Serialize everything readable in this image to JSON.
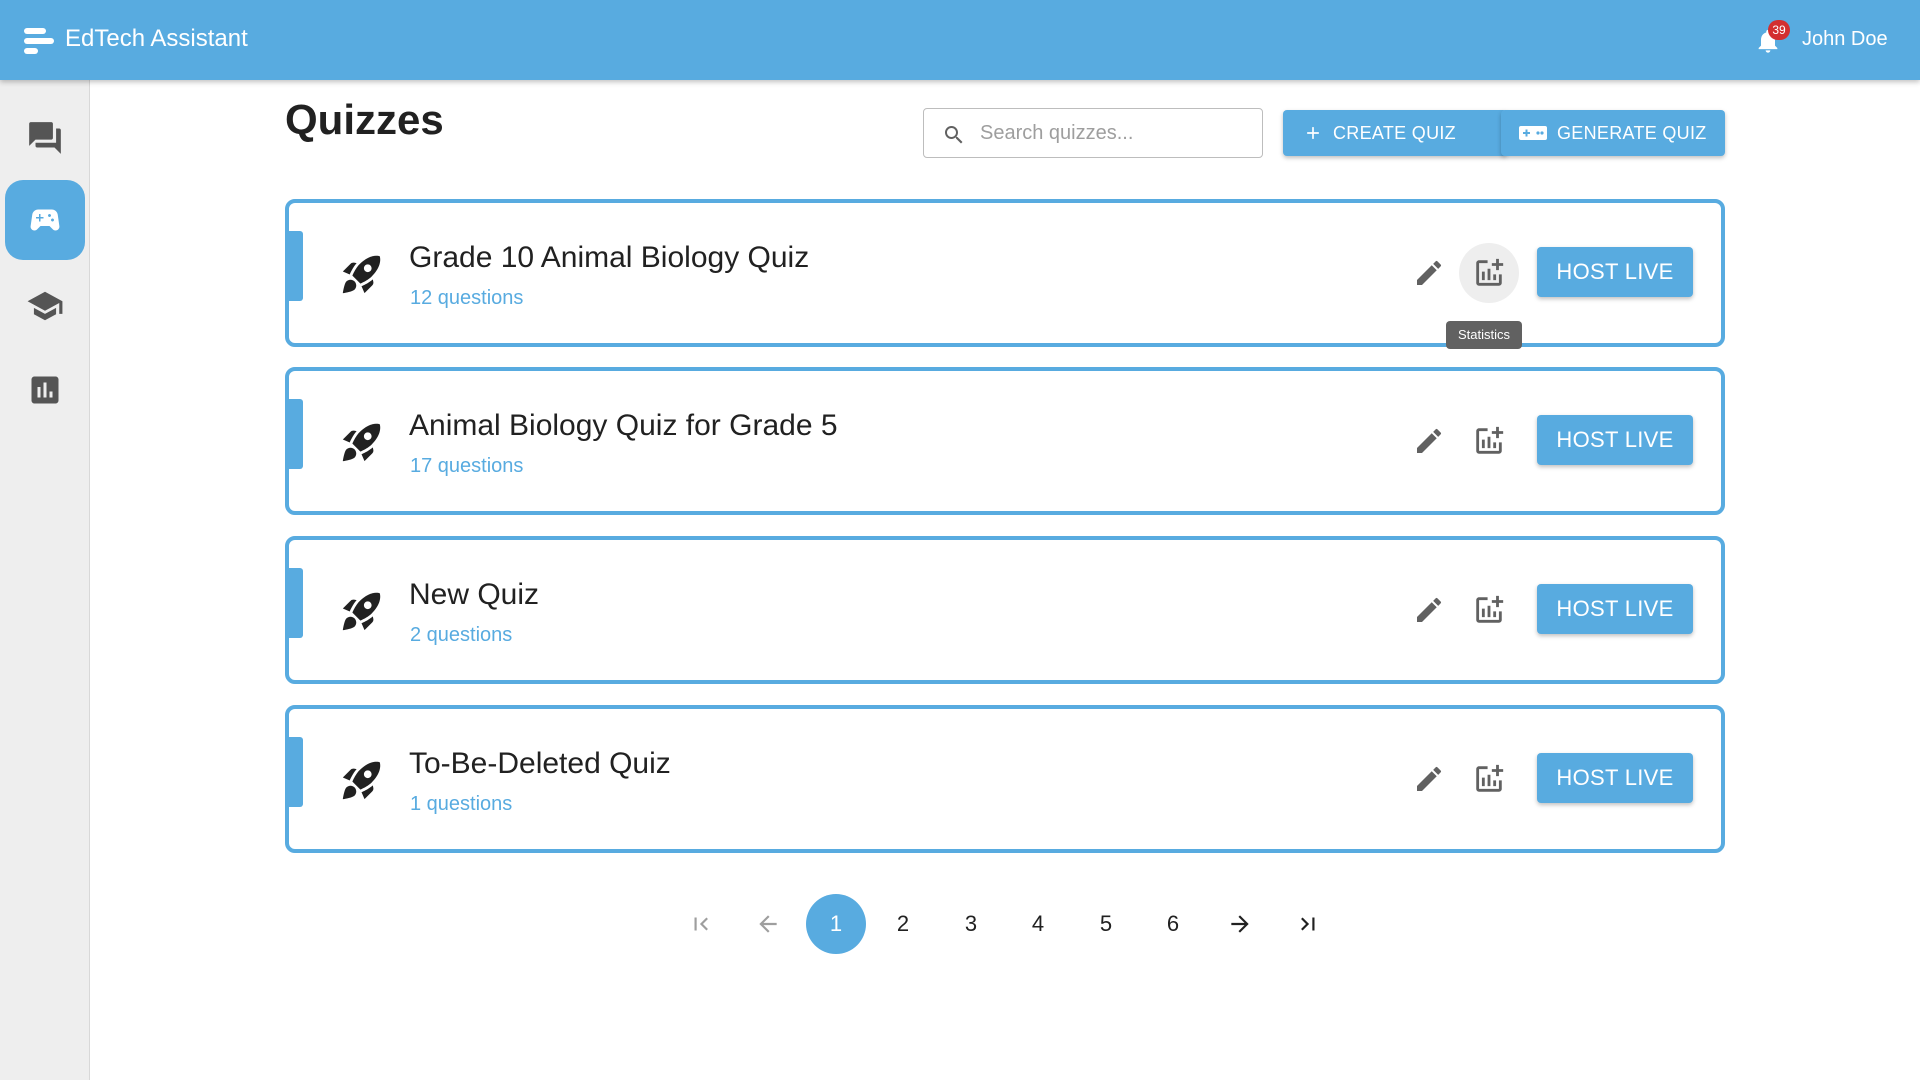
{
  "app": {
    "title": "EdTech Assistant"
  },
  "header": {
    "notification_count": "39",
    "user_name": "John Doe"
  },
  "sidebar": {
    "items": [
      {
        "name": "chat-icon",
        "active": false
      },
      {
        "name": "gamepad-icon",
        "active": true
      },
      {
        "name": "school-icon",
        "active": false
      },
      {
        "name": "bar-chart-icon",
        "active": false
      }
    ]
  },
  "main": {
    "title": "Quizzes",
    "search_placeholder": "Search quizzes...",
    "create_label": "CREATE QUIZ",
    "generate_label": "GENERATE QUIZ"
  },
  "quizzes": [
    {
      "title": "Grade 10 Animal Biology Quiz",
      "count": "12 questions"
    },
    {
      "title": "Animal Biology Quiz for Grade 5",
      "count": "17 questions"
    },
    {
      "title": "New Quiz",
      "count": "2 questions"
    },
    {
      "title": "To-Be-Deleted Quiz",
      "count": "1 questions"
    }
  ],
  "quiz_actions": {
    "host_label": "HOST LIVE"
  },
  "tooltip": {
    "text": "Statistics"
  },
  "pagination": {
    "pages": [
      "1",
      "2",
      "3",
      "4",
      "5",
      "6"
    ],
    "current": "1"
  },
  "colors": {
    "primary": "#58abe0",
    "badge": "#d32f2f",
    "sidebar_bg": "#eeeeee"
  }
}
